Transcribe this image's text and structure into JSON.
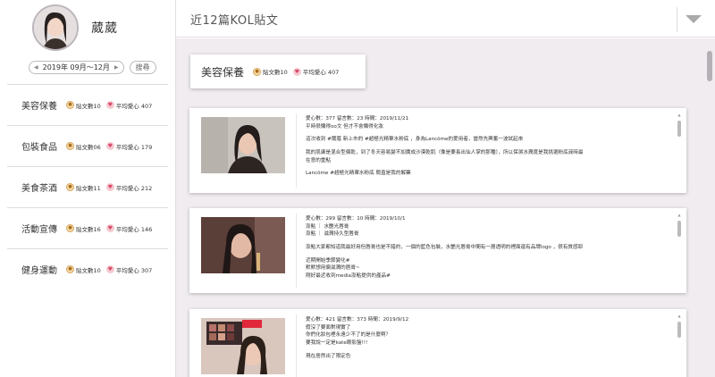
{
  "profile": {
    "name": "葳葳",
    "avatar_icon": "user-avatar"
  },
  "date_range": {
    "label": "2019年 09月～12月",
    "search_label": "搜尋"
  },
  "page_title": "近12篇KOL貼文",
  "categories": [
    {
      "name": "美容保養",
      "posts": "貼文數10",
      "likes": "平均愛心 407"
    },
    {
      "name": "包裝食品",
      "posts": "貼文數06",
      "likes": "平均愛心 179"
    },
    {
      "name": "美食茶酒",
      "posts": "貼文數11",
      "likes": "平均愛心 212"
    },
    {
      "name": "活動宣傳",
      "posts": "貼文數16",
      "likes": "平均愛心 146"
    },
    {
      "name": "健身運動",
      "posts": "貼文數10",
      "likes": "平均愛心 307"
    }
  ],
  "section": {
    "name": "美容保養",
    "posts": "貼文數10",
    "likes": "平均愛心 407"
  },
  "posts": [
    {
      "meta": "愛心數：377 留言數：23 時間：2019/11/21",
      "lines": [
        "平時很懶得oo文 但才不會懶得化妝",
        "",
        "這次收到 #蘭蔻 新上市的 #超極光精華水粉底 ，身為Lancôme的愛用者，當然先興奮一波試起來",
        "",
        "我的肌膚是混合型偏乾，到了冬天容易變不加厲成沙漠乾肌（像是要長出仙人掌的那種），所以保濕水潤度是我挑選粉底液時最",
        "在意的重點",
        "",
        "Lancôme #超極光精華水粉底 簡直是我的解藥"
      ]
    },
    {
      "meta": "愛心數：299 留言數：10 時間：2019/10/1",
      "lines": [
        "澎點 ｜ 水艷光唇膏",
        "澎點 ｜ 滋潤持久型唇膏",
        "",
        "澎點大家都知道我最好用但唇膏也是不錯的，一個的藍色包裝，水艷光唇膏中間有一層透明的裡面還有品牌logo ，很有質感耶",
        "",
        "近期開始季節變化#",
        "默默想用偏滋潤的唇膏~",
        "剛好最近收到media澎點提供的產品#"
      ]
    },
    {
      "meta": "愛心數：421 留言數：373 時間：2019/9/12",
      "lines": [
        "假沒了要面對現實了",
        "你們化妝包裡永遠少不了的是什麼啊？",
        "要我說一定是kate眼影盤!!!",
        "",
        "現在居然出了限定色"
      ]
    }
  ],
  "colors": {
    "accent": "#d8496a",
    "coin": "#d9a55a",
    "background": "#f0ecf0"
  }
}
